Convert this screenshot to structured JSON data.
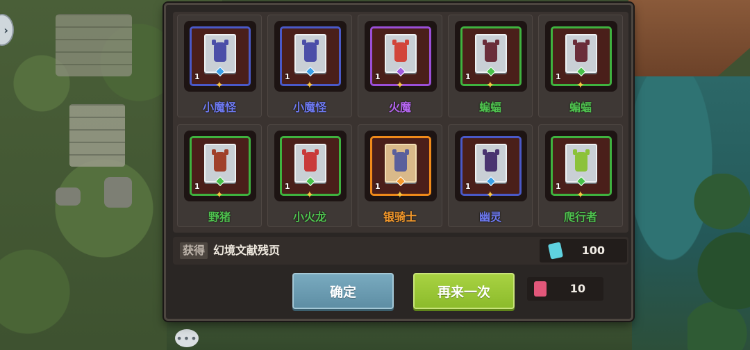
{
  "cards": [
    {
      "name": "小魔怪",
      "count": "1",
      "rarity": "blue",
      "frame_color": "#4a59c8",
      "creature_color": "#4b4ea8",
      "gem_color": "#3aa0e8",
      "icon": "imp-icon"
    },
    {
      "name": "小魔怪",
      "count": "1",
      "rarity": "blue",
      "frame_color": "#4a59c8",
      "creature_color": "#4b4ea8",
      "gem_color": "#3aa0e8",
      "icon": "imp-icon"
    },
    {
      "name": "火魔",
      "count": "1",
      "rarity": "purple",
      "frame_color": "#9b4fd8",
      "creature_color": "#d2453a",
      "gem_color": "#a05be0",
      "icon": "fire-demon-icon"
    },
    {
      "name": "蝙蝠",
      "count": "1",
      "rarity": "green",
      "frame_color": "#3fb33f",
      "creature_color": "#6a2d3a",
      "gem_color": "#48c24a",
      "icon": "bat-icon"
    },
    {
      "name": "蝙蝠",
      "count": "1",
      "rarity": "green",
      "frame_color": "#3fb33f",
      "creature_color": "#6a2d3a",
      "gem_color": "#48c24a",
      "icon": "bat-icon"
    },
    {
      "name": "野猪",
      "count": "1",
      "rarity": "green",
      "frame_color": "#3fb33f",
      "creature_color": "#a0402a",
      "gem_color": "#48c24a",
      "icon": "boar-icon"
    },
    {
      "name": "小火龙",
      "count": "1",
      "rarity": "green",
      "frame_color": "#3fb33f",
      "creature_color": "#c93a3a",
      "gem_color": "#48c24a",
      "icon": "fire-dragon-icon"
    },
    {
      "name": "银骑士",
      "count": "1",
      "rarity": "orange",
      "frame_color": "#f08a1a",
      "creature_color": "#5a5f9c",
      "gem_color": "#f59a2c",
      "icon": "silver-knight-icon"
    },
    {
      "name": "幽灵",
      "count": "1",
      "rarity": "blue",
      "frame_color": "#4a59c8",
      "creature_color": "#4a3470",
      "gem_color": "#3aa0e8",
      "icon": "ghost-icon"
    },
    {
      "name": "爬行者",
      "count": "1",
      "rarity": "green",
      "frame_color": "#3fb33f",
      "creature_color": "#8cc23a",
      "gem_color": "#48c24a",
      "icon": "crawler-icon"
    }
  ],
  "reward": {
    "label": "获得",
    "item": "幻境文献残页"
  },
  "resources": [
    {
      "value": "100",
      "icon": "tome-page-icon",
      "color": "#5fd2e0"
    },
    {
      "value": "10",
      "icon": "scroll-ticket-icon",
      "color": "#e2577a"
    }
  ],
  "buttons": {
    "confirm": "确定",
    "again": "再来一次"
  },
  "icons": {
    "side_arrow": "chevron-right-icon",
    "chat": "chat-bubble-icon"
  }
}
